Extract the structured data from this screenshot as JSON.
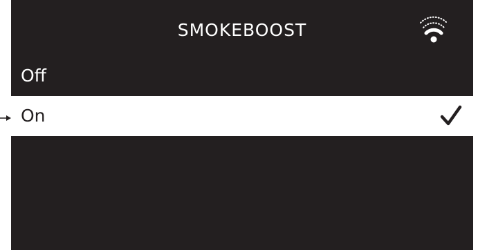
{
  "screen": {
    "title": "SMOKEBOOST",
    "status_icon": "wifi-signal-icon",
    "options": [
      {
        "label": "Off",
        "selected": false
      },
      {
        "label": "On",
        "selected": true
      }
    ],
    "selected_icon": "checkmark-icon"
  },
  "colors": {
    "background": "#231f20",
    "text": "#ffffff",
    "highlight": "#ffffff",
    "highlight_text": "#231f20"
  }
}
